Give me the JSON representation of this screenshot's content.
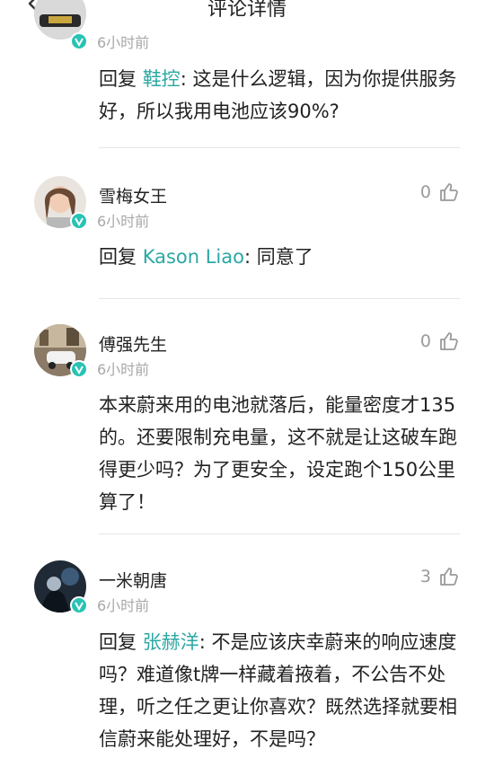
{
  "header": {
    "title": "评论详情"
  },
  "comments": [
    {
      "username": "",
      "time": "6小时前",
      "likes": "",
      "reply_prefix": "回复 ",
      "mention": "鞋控",
      "text": ": 这是什么逻辑，因为你提供服务好，所以我用电池应该90%?"
    },
    {
      "username": "雪梅女王",
      "time": "6小时前",
      "likes": "0",
      "reply_prefix": "回复 ",
      "mention": "Kason Liao",
      "text": ": 同意了"
    },
    {
      "username": "傅强先生",
      "time": "6小时前",
      "likes": "0",
      "text": "本来蔚来用的电池就落后，能量密度才135的。还要限制充电量，这不就是让这破车跑得更少吗？为了更安全，设定跑个150公里算了！"
    },
    {
      "username": "一米朝唐",
      "time": "6小时前",
      "likes": "3",
      "reply_prefix": "回复 ",
      "mention": "张赫洋",
      "text": ": 不是应该庆幸蔚来的响应速度吗？难道像t牌一样藏着掖着，不公告不处理，听之任之更让你喜欢？既然选择就要相信蔚来能处理好，不是吗？"
    }
  ],
  "colors": {
    "accent": "#2ba8a4",
    "badge": "#28c3b4",
    "muted": "#a8a8a8"
  },
  "icons": {
    "back": "chevron-left-icon",
    "like": "thumbs-up-icon",
    "verified": "verified-v-icon"
  }
}
